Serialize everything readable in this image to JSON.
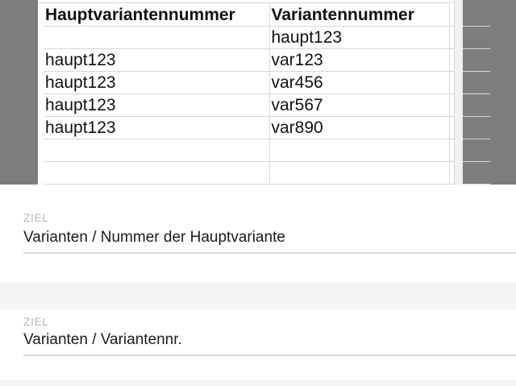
{
  "spreadsheet": {
    "headers": [
      "Hauptvariantennummer",
      "Variantennummer"
    ],
    "rows": [
      [
        "",
        "haupt123"
      ],
      [
        "haupt123",
        "var123"
      ],
      [
        "haupt123",
        "var456"
      ],
      [
        "haupt123",
        "var567"
      ],
      [
        "haupt123",
        "var890"
      ],
      [
        "",
        ""
      ],
      [
        "",
        ""
      ],
      [
        "",
        ""
      ]
    ]
  },
  "mapping": {
    "fields": [
      {
        "label": "ZIEL",
        "value": "Varianten / Nummer der Hauptvariante"
      },
      {
        "label": "ZIEL",
        "value": "Varianten / Variantennr."
      }
    ]
  }
}
